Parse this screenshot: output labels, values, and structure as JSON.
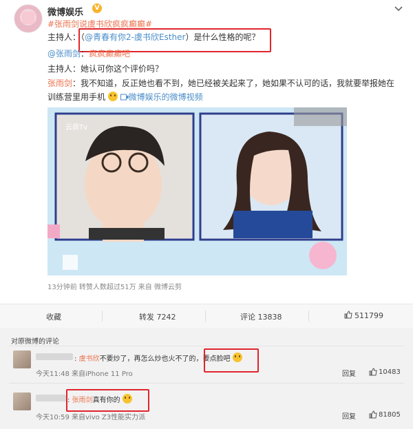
{
  "post": {
    "author": "微博娱乐",
    "verified_mark": "V",
    "topic": "#张雨剑说虞书欣疯疯癫癫#",
    "lines": [
      {
        "speaker": "主持人：",
        "text_a": "（",
        "mention": "@青春有你2-虞书欣Esther",
        "text_b": "）是什么性格的呢？"
      },
      {
        "mention": "@张雨剑",
        "text": "：",
        "tail": "疯疯癫癫吧"
      },
      {
        "speaker": "主持人：",
        "text": "她认可你这个评价吗？"
      },
      {
        "speaker": "张雨剑",
        "text": "：我不知道，反正她也看不到，她已经被关起来了，她如果不认可的话，我就要举报她在"
      },
      {
        "text": "训练营里用手机",
        "video_link": "微博娱乐的微博视频"
      }
    ],
    "meta": "13分钟前 转赞人数超过51万 来自 微博云剪",
    "video": {
      "watermark": "云鼎Tv"
    }
  },
  "actions": {
    "favorite": "收藏",
    "repost": "转发 7242",
    "comment": "评论 13838",
    "like": "511799"
  },
  "comments": {
    "title": "对原微博的评论",
    "items": [
      {
        "user": "虞书欣",
        "text": "不要炒了，再怎么炒也火不了的，",
        "highlight": "要点脸吧",
        "time": "今天11:48 来自iPhone 11 Pro",
        "reply": "回复",
        "likes": "10483"
      },
      {
        "user": "张雨剑",
        "text": "真有你的",
        "time": "今天10:59 来自vivo Z3性能实力派",
        "reply": "回复",
        "likes": "81805"
      }
    ]
  },
  "colors": {
    "accent": "#eb7350",
    "link": "#4a8dc8",
    "highlight_box": "#e0242b"
  }
}
